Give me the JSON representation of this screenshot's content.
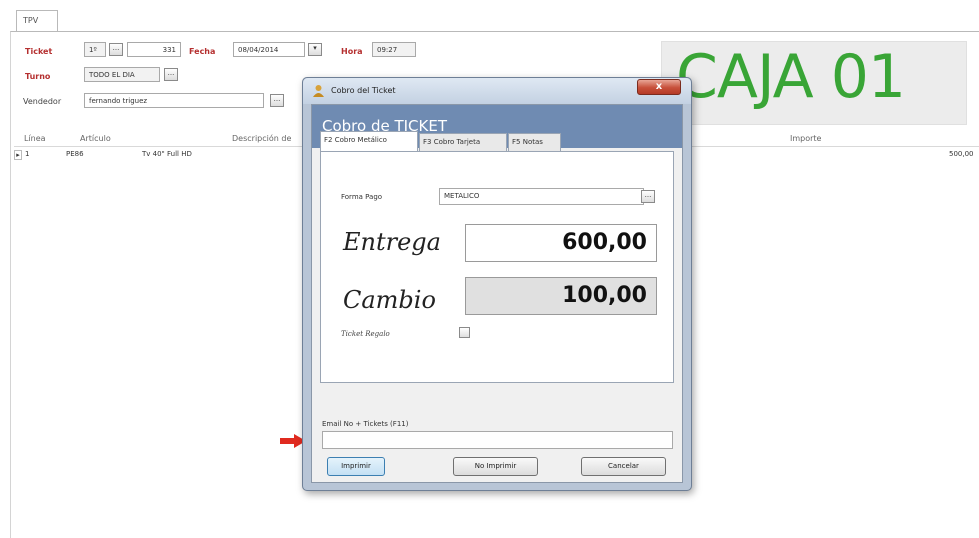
{
  "tpv_tab": "TPV",
  "header": {
    "ticket_label": "Ticket",
    "ticket_series": "1º",
    "ticket_number": "331",
    "fecha_label": "Fecha",
    "fecha_value": "08/04/2014",
    "hora_label": "Hora",
    "hora_value": "09:27",
    "turno_label": "Turno",
    "turno_value": "TODO EL DIA",
    "vendedor_label": "Vendedor",
    "vendedor_value": "fernando triguez"
  },
  "caja": "CAJA 01",
  "grid": {
    "columns": [
      "Línea",
      "Artículo",
      "Descripción de",
      "Importe"
    ],
    "rows": [
      {
        "linea": "1",
        "articulo": "PE86",
        "descripcion": "Tv 40\" Full HD",
        "importe": "500,00"
      }
    ]
  },
  "dialog": {
    "title": "Cobro del Ticket",
    "close": "x",
    "header": "Cobro de TICKET",
    "tabs": [
      "F2 Cobro Metálico",
      "F3 Cobro Tarjeta",
      "F5 Notas"
    ],
    "forma_pago_label": "Forma Pago",
    "forma_pago_value": "METALICO",
    "entrega_label": "Entrega",
    "entrega_value": "600,00",
    "cambio_label": "Cambio",
    "cambio_value": "100,00",
    "ticket_regalo_label": "Ticket Regalo",
    "email_label": "Email No + Tickets (F11)",
    "buttons": {
      "imprimir": "Imprimir",
      "no_imprimir": "No Imprimir",
      "cancelar": "Cancelar"
    }
  },
  "colors": {
    "caja_green": "#39a536",
    "header_blue": "#6f8bb2",
    "label_red": "#b53030",
    "arrow_red": "#e02a1f"
  },
  "icons": {
    "ellipsis_button": "...",
    "dropdown_arrow": "▾",
    "row_indicator": "▸"
  }
}
